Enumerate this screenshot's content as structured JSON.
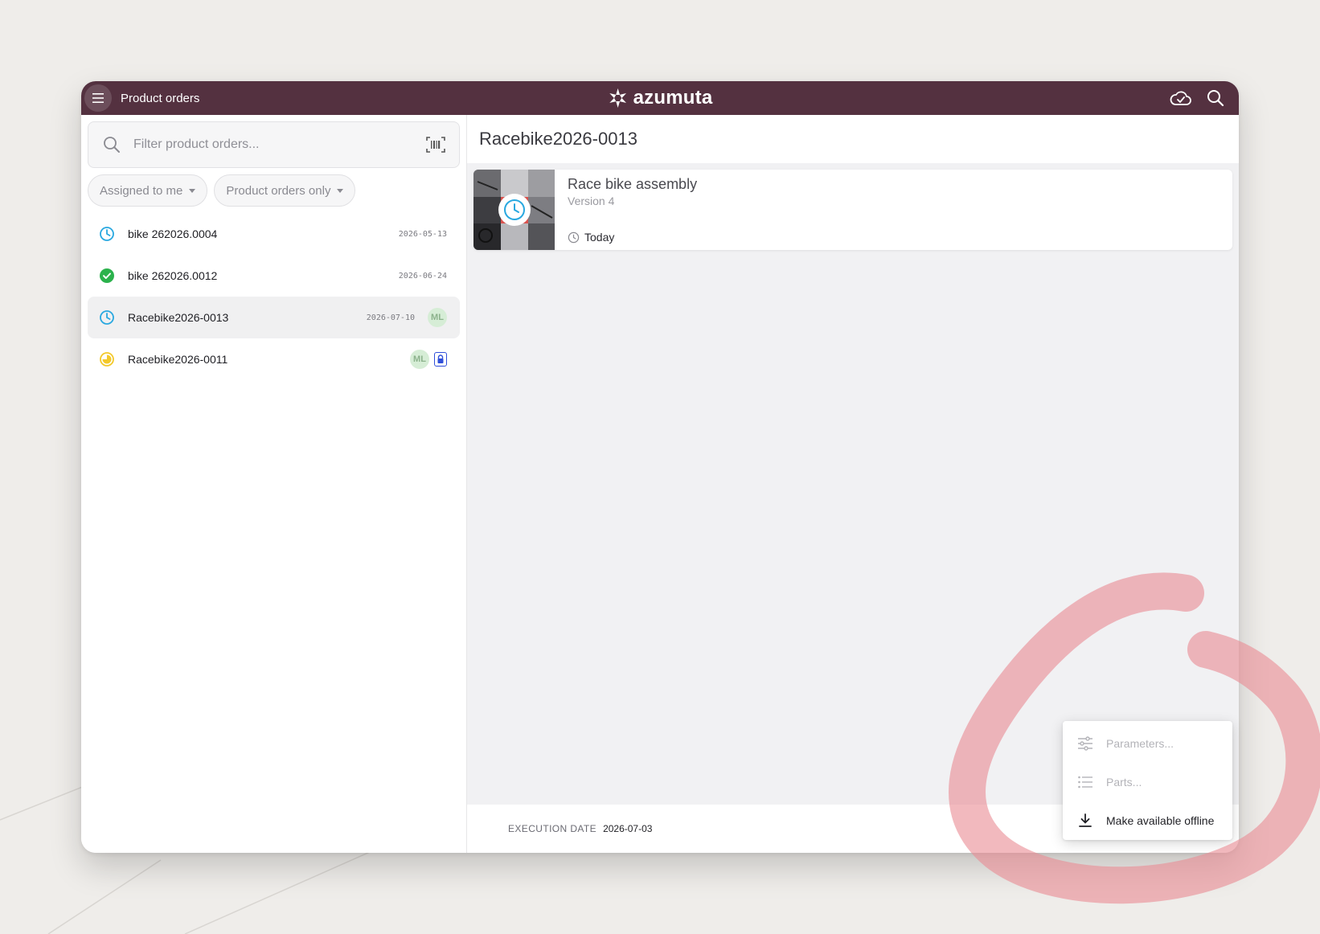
{
  "app": {
    "window_title": "Product orders",
    "brand": "azumuta"
  },
  "search": {
    "placeholder": "Filter product orders..."
  },
  "filters": [
    {
      "label": "Assigned to me"
    },
    {
      "label": "Product orders only"
    }
  ],
  "orders": [
    {
      "name": "bike 262026.0004",
      "date": "2026-05-13",
      "status": "clock-icon",
      "status_color": "#29a8e0"
    },
    {
      "name": "bike 262026.0012",
      "date": "2026-06-24",
      "status": "check-circle-icon",
      "status_color": "#2bb24c"
    },
    {
      "name": "Racebike2026-0013",
      "date": "2026-07-10",
      "status": "clock-icon",
      "status_color": "#29a8e0",
      "assignee": "ML",
      "selected": true
    },
    {
      "name": "Racebike2026-0011",
      "date": "",
      "status": "pie-progress-icon",
      "status_color": "#f3c92b",
      "assignee": "ML",
      "locked": true
    }
  ],
  "detail": {
    "title": "Racebike2026-0013",
    "card": {
      "title": "Race bike assembly",
      "version": "Version 4",
      "time": "Today"
    },
    "footer": {
      "label": "EXECUTION DATE",
      "value": "2026-07-03"
    }
  },
  "menu": {
    "items": [
      {
        "label": "Parameters...",
        "icon": "sliders-icon",
        "enabled": false
      },
      {
        "label": "Parts...",
        "icon": "list-icon",
        "enabled": false
      },
      {
        "label": "Make available offline",
        "icon": "download-icon",
        "enabled": true
      }
    ]
  },
  "colors": {
    "topbar": "#543140",
    "accent_blue": "#29a8e0",
    "success_green": "#2bb24c",
    "warning_yellow": "#f3c92b",
    "annotation_red": "#e98a92"
  }
}
